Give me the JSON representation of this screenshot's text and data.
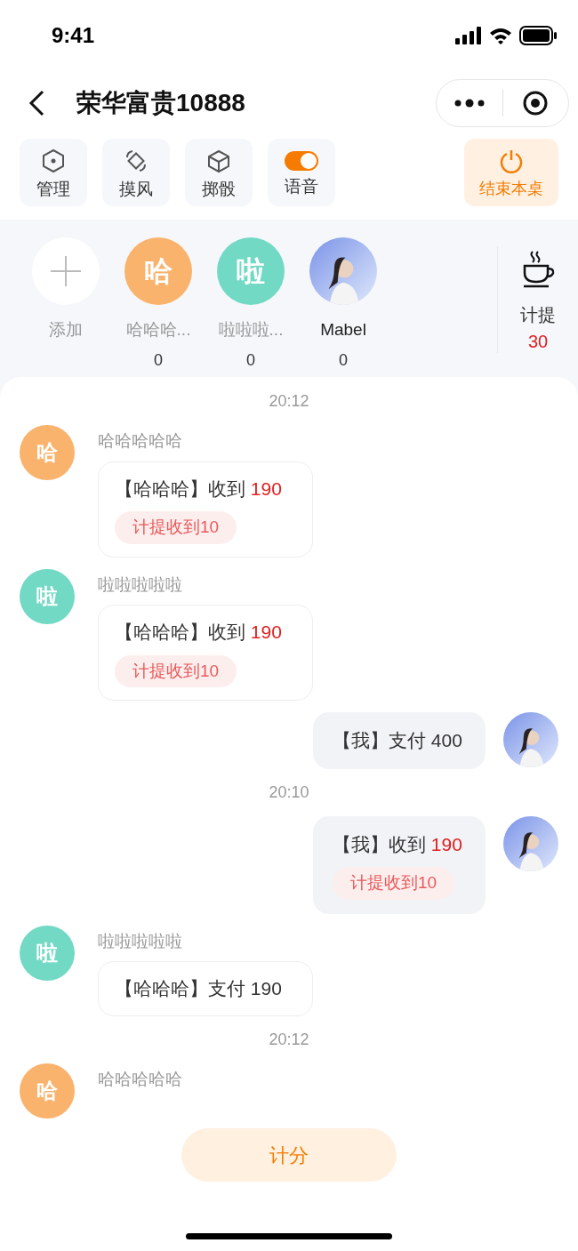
{
  "status_bar": {
    "time": "9:41"
  },
  "nav": {
    "title": "荣华富贵10888"
  },
  "tools": [
    {
      "kind": "hexagon",
      "label": "管理"
    },
    {
      "kind": "spin",
      "label": "摸风"
    },
    {
      "kind": "cube",
      "label": "掷骰"
    },
    {
      "kind": "toggle",
      "label": "语音",
      "on": true
    }
  ],
  "end_button": {
    "label": "结束本桌"
  },
  "players": [
    {
      "kind": "add",
      "name": "添加"
    },
    {
      "kind": "letter",
      "letter": "哈",
      "color": "#f9b36d",
      "name": "哈哈哈...",
      "score": "0"
    },
    {
      "kind": "letter",
      "letter": "啦",
      "color": "#72d9c4",
      "name": "啦啦啦...",
      "score": "0"
    },
    {
      "kind": "photo",
      "name": "Mabel",
      "score": "0"
    }
  ],
  "fee": {
    "label": "计提",
    "value": "30"
  },
  "messages": [
    {
      "kind": "time",
      "text": "20:12"
    },
    {
      "kind": "left",
      "avatar": {
        "kind": "letter",
        "letter": "哈",
        "color": "#f9b36d"
      },
      "sender": "哈哈哈哈哈",
      "text": "【哈哈哈】收到 ",
      "amount": "190",
      "highlight": true,
      "tag": "计提收到10"
    },
    {
      "kind": "left",
      "avatar": {
        "kind": "letter",
        "letter": "啦",
        "color": "#72d9c4"
      },
      "sender": "啦啦啦啦啦",
      "text": "【哈哈哈】收到 ",
      "amount": "190",
      "highlight": true,
      "tag": "计提收到10"
    },
    {
      "kind": "right",
      "avatar": {
        "kind": "photo"
      },
      "text": "【我】支付 ",
      "amount": "400",
      "highlight": false
    },
    {
      "kind": "time",
      "text": "20:10"
    },
    {
      "kind": "right",
      "avatar": {
        "kind": "photo"
      },
      "text": "【我】收到 ",
      "amount": "190",
      "highlight": true,
      "tag": "计提收到10"
    },
    {
      "kind": "left",
      "avatar": {
        "kind": "letter",
        "letter": "啦",
        "color": "#72d9c4"
      },
      "sender": "啦啦啦啦啦",
      "text": "【哈哈哈】支付 ",
      "amount": "190",
      "highlight": false
    },
    {
      "kind": "time",
      "text": "20:12"
    },
    {
      "kind": "left",
      "avatar": {
        "kind": "letter",
        "letter": "哈",
        "color": "#f9b36d"
      },
      "sender": "哈哈哈哈哈"
    }
  ],
  "score_button": {
    "label": "计分"
  }
}
